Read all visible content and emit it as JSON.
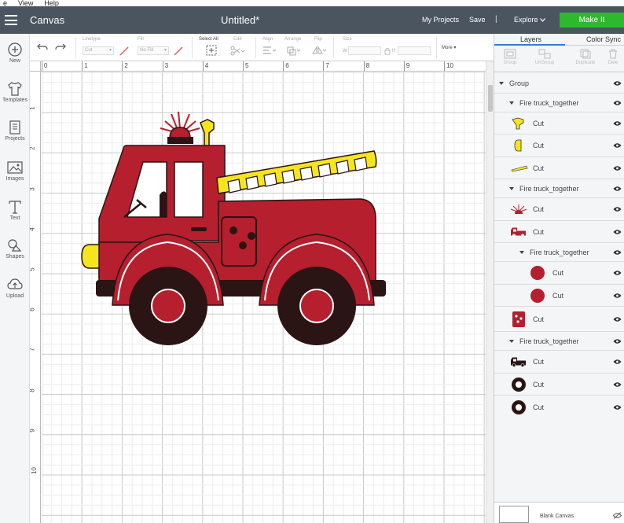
{
  "menubar": {
    "items": [
      "e",
      "View",
      "Help"
    ]
  },
  "topbar": {
    "app_title": "Canvas",
    "doc_title": "Untitled*",
    "my_projects": "My Projects",
    "save": "Save",
    "separator": "|",
    "explore": "Explore",
    "make_it": "Make It"
  },
  "sidebar": {
    "items": [
      {
        "label": "New",
        "icon": "plus-circle-icon"
      },
      {
        "label": "Templates",
        "icon": "tshirt-icon"
      },
      {
        "label": "Projects",
        "icon": "projects-icon"
      },
      {
        "label": "Images",
        "icon": "image-icon"
      },
      {
        "label": "Text",
        "icon": "text-t-icon"
      },
      {
        "label": "Shapes",
        "icon": "shapes-icon"
      },
      {
        "label": "Upload",
        "icon": "cloud-upload-icon"
      }
    ]
  },
  "toolbar": {
    "linetype_label": "Linetype",
    "linetype_value": "Cut",
    "fill_label": "Fill",
    "fill_value": "No Fill",
    "select_all": "Select All",
    "edit": "Edit",
    "align": "Align",
    "arrange": "Arrange",
    "flip": "Flip",
    "size": "Size",
    "w_label": "W",
    "h_label": "H",
    "more": "More"
  },
  "ruler": {
    "top": [
      "0",
      "1",
      "2",
      "3",
      "4",
      "5",
      "6",
      "7",
      "8",
      "9",
      "10"
    ],
    "left": [
      "1",
      "2",
      "3",
      "4",
      "5",
      "6",
      "7",
      "8",
      "9",
      "10"
    ]
  },
  "panel": {
    "tabs": [
      "Layers",
      "Color Sync"
    ],
    "tools": [
      "Group",
      "UnGroup",
      "Duplicate",
      "Dele"
    ],
    "layers": [
      {
        "label": "Group",
        "type": "group"
      },
      {
        "label": "Fire truck_together",
        "type": "subgroup"
      },
      {
        "label": "Cut",
        "thumb": "yellow-horn"
      },
      {
        "label": "Cut",
        "thumb": "yellow-light"
      },
      {
        "label": "Cut",
        "thumb": "yellow-ladder"
      },
      {
        "label": "Fire truck_together",
        "type": "subgroup"
      },
      {
        "label": "Cut",
        "thumb": "red-siren"
      },
      {
        "label": "Cut",
        "thumb": "red-truck"
      },
      {
        "label": "Fire truck_together",
        "type": "subgroup2"
      },
      {
        "label": "Cut",
        "thumb": "red-circle"
      },
      {
        "label": "Cut",
        "thumb": "red-circle"
      },
      {
        "label": "Cut",
        "thumb": "red-square"
      },
      {
        "label": "Fire truck_together",
        "type": "subgroup"
      },
      {
        "label": "Cut",
        "thumb": "black-truck"
      },
      {
        "label": "Cut",
        "thumb": "black-ring"
      },
      {
        "label": "Cut",
        "thumb": "black-ring"
      }
    ],
    "blank_canvas": "Blank Canvas"
  },
  "colors": {
    "topbar": "#4b5560",
    "make_it": "#2eb82e",
    "truck_red": "#b51f2e",
    "truck_yellow": "#f4e51f",
    "truck_black": "#2a1414"
  }
}
